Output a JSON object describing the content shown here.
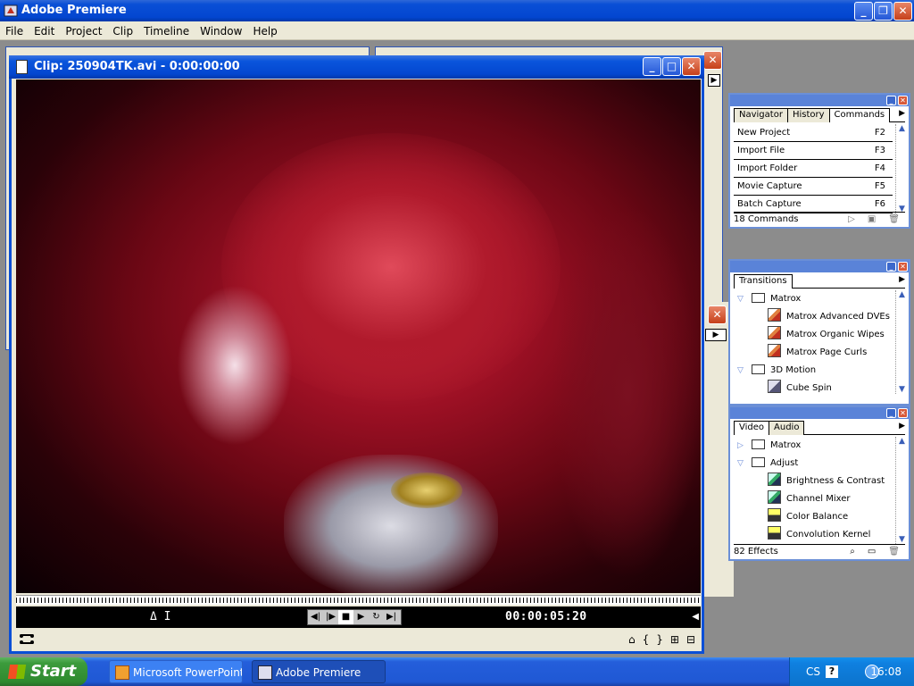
{
  "app": {
    "title": "Adobe Premiere"
  },
  "menu": [
    "File",
    "Edit",
    "Project",
    "Clip",
    "Timeline",
    "Window",
    "Help"
  ],
  "clip_window": {
    "title": "Clip: 250904TK.avi - 0:00:00:00",
    "delta_label": "Δ I",
    "timecode": "00:00:05:20"
  },
  "commands_palette": {
    "tabs": [
      "Navigator",
      "History",
      "Commands"
    ],
    "active_tab": "Commands",
    "items": [
      {
        "label": "New Project",
        "key": "F2"
      },
      {
        "label": "Import File",
        "key": "F3"
      },
      {
        "label": "Import Folder",
        "key": "F4"
      },
      {
        "label": "Movie Capture",
        "key": "F5"
      },
      {
        "label": "Batch Capture",
        "key": "F6"
      }
    ],
    "footer": "18 Commands"
  },
  "transitions_palette": {
    "tabs": [
      "Transitions"
    ],
    "items": [
      {
        "type": "folder",
        "label": "Matrox"
      },
      {
        "type": "fx",
        "label": "Matrox Advanced DVEs"
      },
      {
        "type": "fx",
        "label": "Matrox Organic Wipes"
      },
      {
        "type": "fx",
        "label": "Matrox Page Curls"
      },
      {
        "type": "folder",
        "label": "3D Motion"
      },
      {
        "type": "fx",
        "label": "Cube Spin"
      }
    ]
  },
  "effects_palette": {
    "tabs": [
      "Video",
      "Audio"
    ],
    "active_tab": "Video",
    "items": [
      {
        "type": "folder-collapsed",
        "label": "Matrox"
      },
      {
        "type": "folder",
        "label": "Adjust"
      },
      {
        "type": "fx",
        "label": "Brightness & Contrast"
      },
      {
        "type": "fx",
        "label": "Channel Mixer"
      },
      {
        "type": "fx",
        "label": "Color Balance"
      },
      {
        "type": "fx",
        "label": "Convolution Kernel"
      }
    ],
    "footer": "82 Effects"
  },
  "taskbar": {
    "start_label": "Start",
    "buttons": [
      "Microsoft PowerPoint ...",
      "Adobe Premiere"
    ],
    "active": "Adobe Premiere",
    "lang": "CS",
    "clock": "16:08"
  }
}
